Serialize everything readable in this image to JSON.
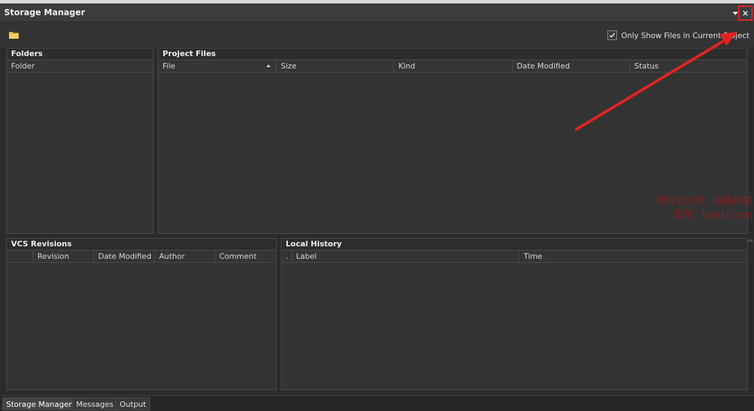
{
  "window": {
    "title": "Storage Manager",
    "close_label": "×"
  },
  "toolbar": {
    "only_show_label": "Only Show Files in Current Project",
    "only_show_checked": true
  },
  "folders": {
    "title": "Folders",
    "columns": [
      "Folder"
    ]
  },
  "project_files": {
    "title": "Project Files",
    "columns": [
      "File",
      "Size",
      "Kind",
      "Date Modified",
      "Status"
    ]
  },
  "vcs": {
    "title": "VCS Revisions",
    "columns": [
      "",
      "Revision",
      "Date Modified",
      "Author",
      "Comment"
    ]
  },
  "local_history": {
    "title": "Local History",
    "columns": [
      ".",
      "Label",
      "Time"
    ]
  },
  "watermark": {
    "line1": "微信公众号：探临科技",
    "line2": "官网：tanlkj.com"
  },
  "bottom_tabs": [
    "Storage Manager",
    "Messages",
    "Output"
  ],
  "colors": {
    "highlight": "#e52222",
    "bg": "#2b2b2b"
  }
}
